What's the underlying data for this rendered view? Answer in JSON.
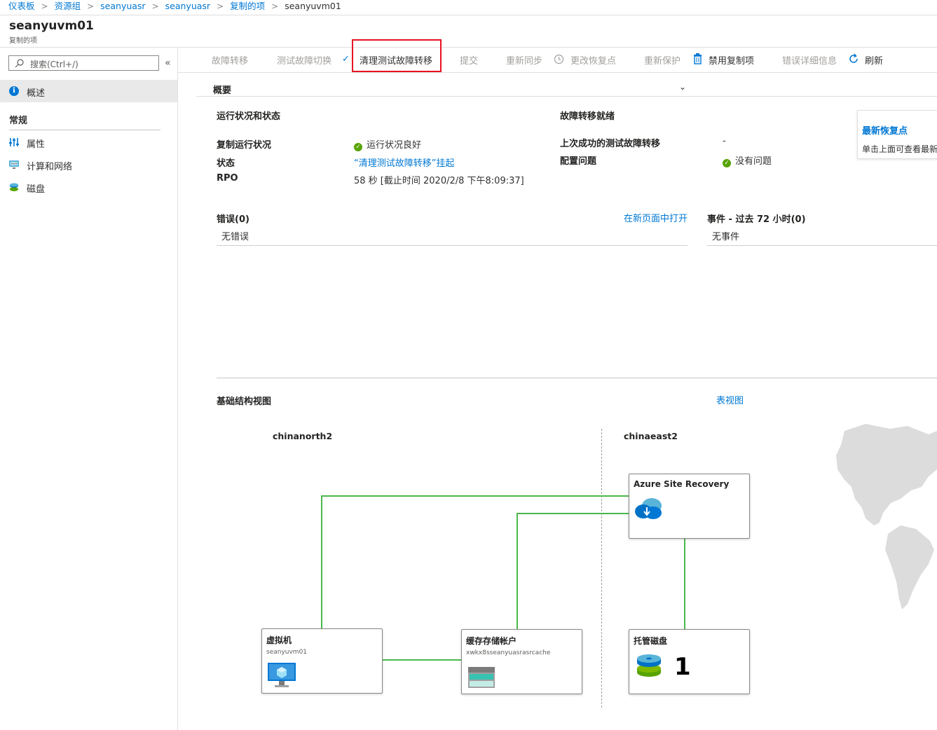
{
  "breadcrumb": {
    "items": [
      "仪表板",
      "资源组",
      "seanyuasr",
      "seanyuasr",
      "复制的项",
      "seanyuvm01"
    ]
  },
  "header": {
    "title": "seanyuvm01",
    "subtitle": "复制的项"
  },
  "sidebar": {
    "search_placeholder": "搜索(Ctrl+/)",
    "overview_label": "概述",
    "section_general": "常规",
    "items": [
      {
        "label": "属性",
        "icon": "properties-icon"
      },
      {
        "label": "计算和网络",
        "icon": "compute-network-icon"
      },
      {
        "label": "磁盘",
        "icon": "disk-icon"
      }
    ]
  },
  "toolbar": {
    "failover": "故障转移",
    "test_failover": "测试故障切换",
    "cleanup_test_failover": "清理测试故障转移",
    "commit": "提交",
    "resync": "重新同步",
    "change_recovery_point": "更改恢复点",
    "reprotect": "重新保护",
    "disable_replication": "禁用复制项",
    "error_details": "错误详细信息",
    "refresh": "刷新"
  },
  "overview": {
    "section_label": "概要",
    "health_title": "运行状况和状态",
    "replication_health_label": "复制运行状况",
    "replication_health_value": "运行状况良好",
    "status_label": "状态",
    "status_value": "“清理测试故障转移”挂起",
    "rpo_label": "RPO",
    "rpo_value": "58 秒 [截止时间 2020/2/8 下午8:09:37]",
    "failover_ready_title": "故障转移就绪",
    "last_test_failover_label": "上次成功的测试故障转移",
    "last_test_failover_value": "-",
    "config_issues_label": "配置问题",
    "config_issues_value": "没有问题",
    "latest_rp_title": "最新恢复点",
    "latest_rp_desc": "单击上面可查看最新"
  },
  "errors": {
    "title": "错误(0)",
    "open_link": "在新页面中打开",
    "empty": "无错误"
  },
  "events": {
    "title": "事件 - 过去 72 小时(0)",
    "empty": "无事件"
  },
  "infra": {
    "title": "基础结构视图",
    "table_view_link": "表视图",
    "region_source": "chinanorth2",
    "region_target": "chinaeast2",
    "vm_title": "虚拟机",
    "vm_name": "seanyuvm01",
    "cache_title": "缓存存储帐户",
    "cache_name": "xwkx8sseanyuasrasrcache",
    "asr_title": "Azure Site Recovery",
    "disk_title": "托管磁盘",
    "disk_count": "1"
  }
}
